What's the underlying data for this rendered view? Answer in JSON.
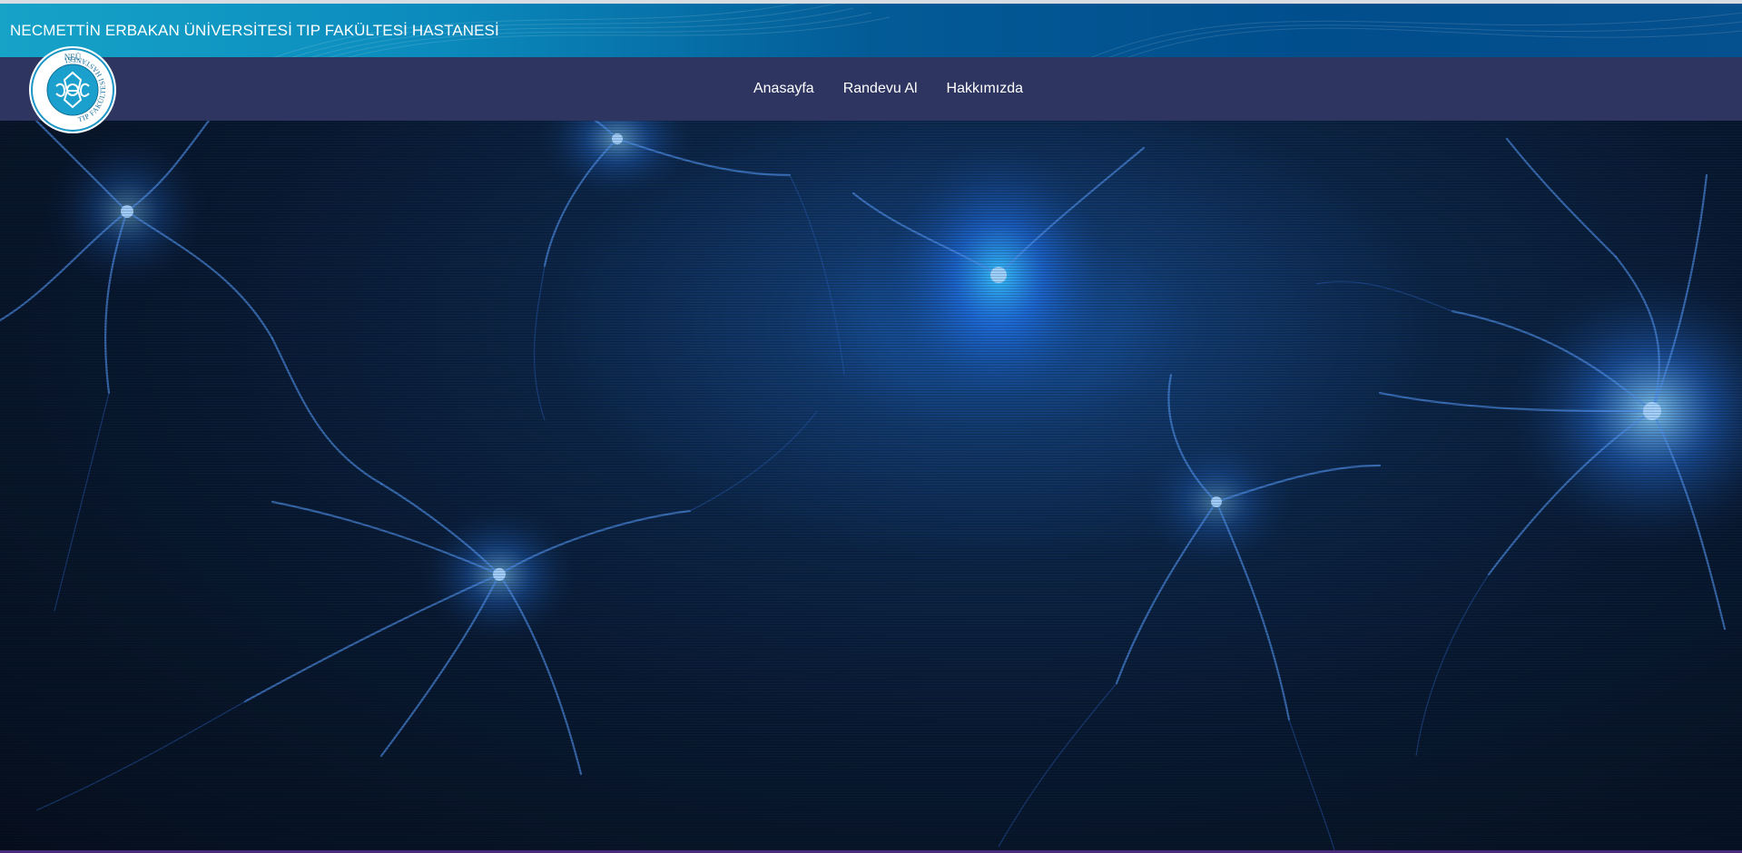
{
  "header": {
    "title": "NECMETTİN ERBAKAN ÜNİVERSİTESİ TIP FAKÜLTESİ HASTANESİ"
  },
  "logo": {
    "top_text": "NEÜ",
    "ring_text": "TIP FAKÜLTESİ HASTANESİ"
  },
  "nav": {
    "items": [
      {
        "label": "Anasayfa"
      },
      {
        "label": "Randevu Al"
      },
      {
        "label": "Hakkımızda"
      }
    ]
  },
  "colors": {
    "title_bar_start": "#16a3c8",
    "title_bar_end": "#014e8d",
    "nav_bar": "#2e3561",
    "hero_dark": "#060f1e",
    "neuron_glow": "#3a8cff"
  }
}
